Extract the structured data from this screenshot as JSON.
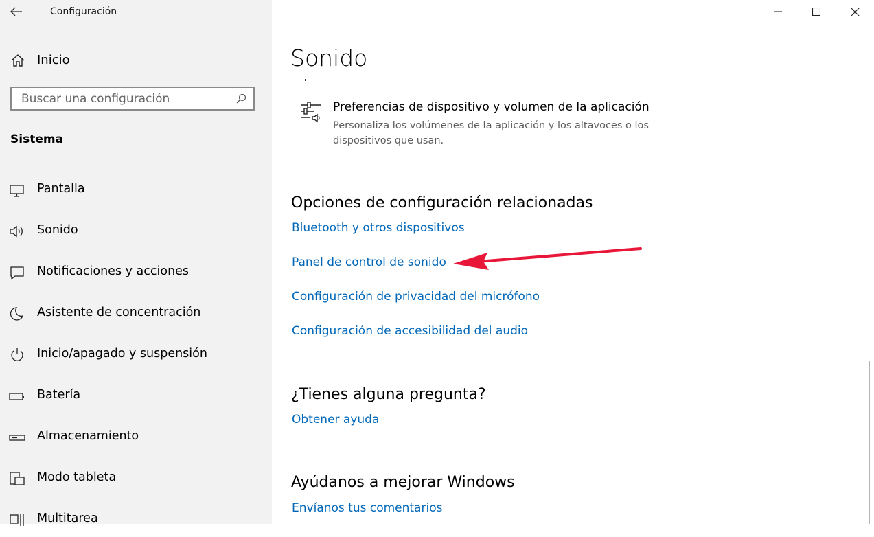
{
  "window": {
    "app_title": "Configuración",
    "controls": {
      "back": "back-arrow-icon",
      "minimize": "minimize-icon",
      "maximize": "maximize-icon",
      "close": "close-icon"
    }
  },
  "sidebar": {
    "home_label": "Inicio",
    "search_placeholder": "Buscar una configuración",
    "section_title": "Sistema",
    "items": [
      {
        "label": "Pantalla",
        "icon": "monitor-icon"
      },
      {
        "label": "Sonido",
        "icon": "speaker-icon"
      },
      {
        "label": "Notificaciones y acciones",
        "icon": "message-icon"
      },
      {
        "label": "Asistente de concentración",
        "icon": "moon-icon"
      },
      {
        "label": "Inicio/apagado y suspensión",
        "icon": "power-icon"
      },
      {
        "label": "Batería",
        "icon": "battery-icon"
      },
      {
        "label": "Almacenamiento",
        "icon": "storage-icon"
      },
      {
        "label": "Modo tableta",
        "icon": "tablet-icon"
      },
      {
        "label": "Multitarea",
        "icon": "multitask-icon"
      }
    ]
  },
  "main": {
    "title": "Sonido",
    "pref_item": {
      "title": "Preferencias de dispositivo y volumen de la aplicación",
      "description": "Personaliza los volúmenes de la aplicación y los altavoces o los dispositivos que usan.",
      "icon": "sliders-speaker-icon"
    },
    "related": {
      "heading": "Opciones de configuración relacionadas",
      "links": [
        "Bluetooth y otros dispositivos",
        "Panel de control de sonido",
        "Configuración de privacidad del micrófono",
        "Configuración de accesibilidad del audio"
      ]
    },
    "question": {
      "heading": "¿Tienes alguna pregunta?",
      "link": "Obtener ayuda"
    },
    "feedback": {
      "heading": "Ayúdanos a mejorar Windows",
      "link": "Envíanos tus comentarios"
    },
    "annotation": {
      "type": "arrow",
      "color": "#e8173a",
      "points_to": "Panel de control de sonido"
    }
  },
  "colors": {
    "link": "#0067b8",
    "sidebar_bg": "#f2f2f2",
    "annotation_arrow": "#e8173a"
  }
}
